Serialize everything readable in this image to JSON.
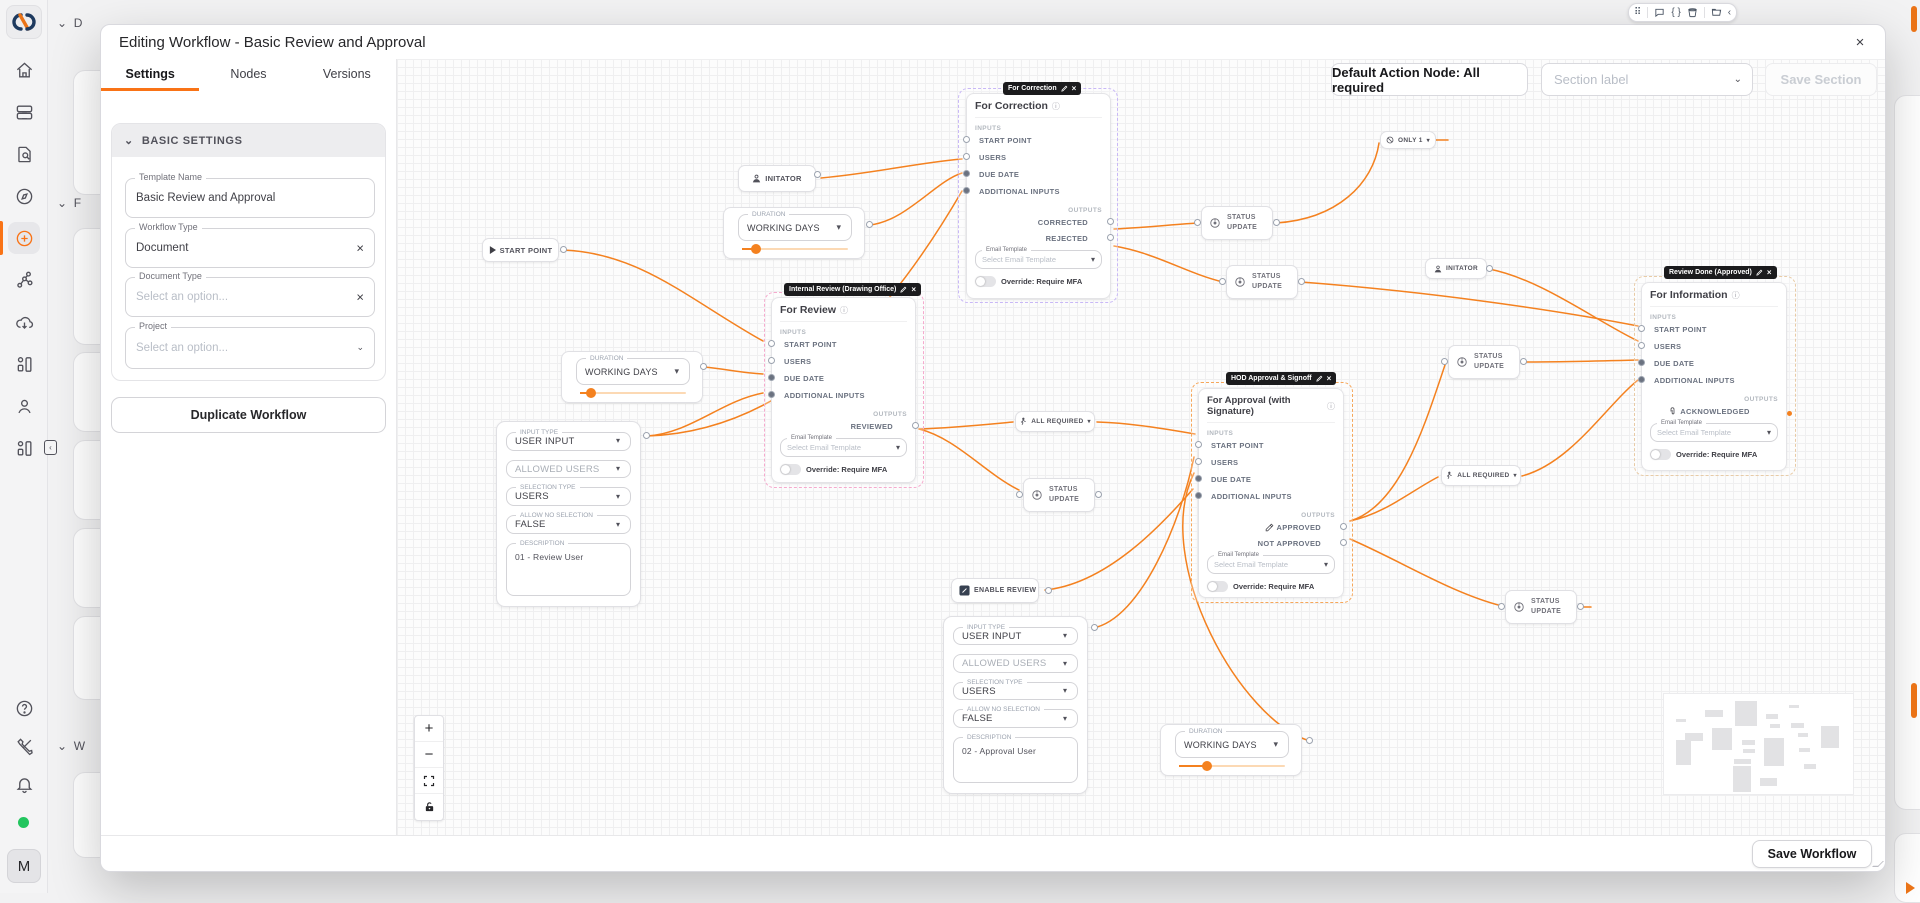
{
  "icons": {
    "close": "×",
    "chevron_down": "▾",
    "chevron_left": "‹",
    "braces": "{ }",
    "drag_handle": "⠿",
    "info": "ⓘ",
    "zoom_in": "+",
    "zoom_out": "−",
    "clear": "×"
  },
  "app": {
    "avatar": "M",
    "accent_color": "#f97316",
    "sidebar_icons": [
      "logo",
      "home",
      "archive",
      "file-search",
      "compass",
      "create-plus (active)",
      "workflow",
      "cloud-download",
      "apps",
      "user",
      "apps-panel",
      "help",
      "tools",
      "notifications",
      "online-status",
      "avatar"
    ],
    "background_section_labels": {
      "s1": "D",
      "s2": "F",
      "s3": "W"
    }
  },
  "toolbar": {
    "icons": [
      "drag-handle",
      "comment",
      "braces",
      "bucket",
      "folder",
      "chevron-left"
    ]
  },
  "modal": {
    "title": "Editing Workflow - Basic Review and Approval",
    "tabs": {
      "t1": "Settings",
      "t2": "Nodes",
      "t3": "Versions",
      "active": "Settings"
    },
    "settings": {
      "section_title": "BASIC SETTINGS",
      "template_name": {
        "label": "Template Name",
        "value": "Basic Review and Approval"
      },
      "workflow_type": {
        "label": "Workflow Type",
        "value": "Document"
      },
      "document_type": {
        "label": "Document Type",
        "placeholder": "Select an option..."
      },
      "project": {
        "label": "Project",
        "placeholder": "Select an option..."
      },
      "duplicate_button": "Duplicate Workflow"
    },
    "canvas_header": {
      "default_action": "Default Action Node: All required",
      "section_label_placeholder": "Section label",
      "save_section_button": "Save Section"
    },
    "footer": {
      "save_button": "Save Workflow"
    }
  },
  "canvas": {
    "labels": {
      "inputs": "INPUTS",
      "outputs": "OUTPUTS",
      "email_label": "Email Template",
      "email_placeholder": "Select Email Template",
      "mfa": "Override: Require MFA",
      "duration": "DURATION",
      "working_days": "WORKING DAYS",
      "start_point": "START POINT",
      "initiator": "INITATOR",
      "only_one": "ONLY 1",
      "all_required": "ALL REQUIRED",
      "status_update": "STATUS UPDATE",
      "enable_review": "ENABLE REVIEW"
    },
    "action_nodes": {
      "correction": {
        "badge": "For Correction",
        "title": "For Correction",
        "inputs": [
          "START POINT",
          "USERS",
          "DUE DATE",
          "ADDITIONAL INPUTS"
        ],
        "outputs": [
          "CORRECTED",
          "REJECTED"
        ],
        "selection_color": "#c9b8f7"
      },
      "review": {
        "badge": "Internal Review (Drawing Office)",
        "title": "For Review",
        "inputs": [
          "START POINT",
          "USERS",
          "DUE DATE",
          "ADDITIONAL INPUTS"
        ],
        "outputs": [
          "REVIEWED"
        ],
        "selection_color": "#f5aacd"
      },
      "approval": {
        "badge": "HOD Approval & Signoff",
        "title": "For Approval (with Signature)",
        "inputs": [
          "START POINT",
          "USERS",
          "DUE DATE",
          "ADDITIONAL INPUTS"
        ],
        "outputs": [
          "APPROVED",
          "NOT APPROVED"
        ],
        "selection_color": "#f6a75a"
      },
      "information": {
        "badge": "Review Done (Approved)",
        "title": "For Information",
        "inputs": [
          "START POINT",
          "USERS",
          "DUE DATE",
          "ADDITIONAL INPUTS"
        ],
        "outputs": [
          "ACKNOWLEDGED"
        ],
        "selection_color": "#e8cba6"
      }
    },
    "user_input_panels": {
      "labels": {
        "input_type": "INPUT TYPE",
        "user_input": "USER INPUT",
        "allowed_users": "ALLOWED USERS",
        "selection_type": "SELECTION TYPE",
        "users": "USERS",
        "allow_no_selection": "ALLOW NO SELECTION",
        "false_value": "FALSE",
        "description": "DESCRIPTION"
      },
      "panel1_description": "01 - Review User",
      "panel2_description": "02 - Approval User"
    },
    "edge_color": "#f4811f"
  }
}
